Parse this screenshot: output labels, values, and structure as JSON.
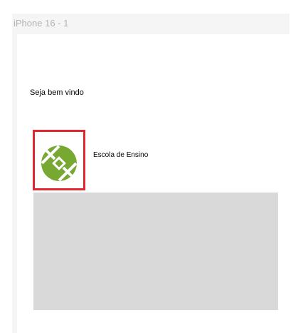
{
  "frame": {
    "label": "iPhone 16 - 1"
  },
  "screen": {
    "welcome_text": "Seja bem vindo",
    "school_name": "Escola de Ensino",
    "logo_icon": "green-circle-logo-icon"
  },
  "colors": {
    "logo_green": "#76a832",
    "selection_red": "#e0262e",
    "placeholder_gray": "#d9d9d9"
  }
}
